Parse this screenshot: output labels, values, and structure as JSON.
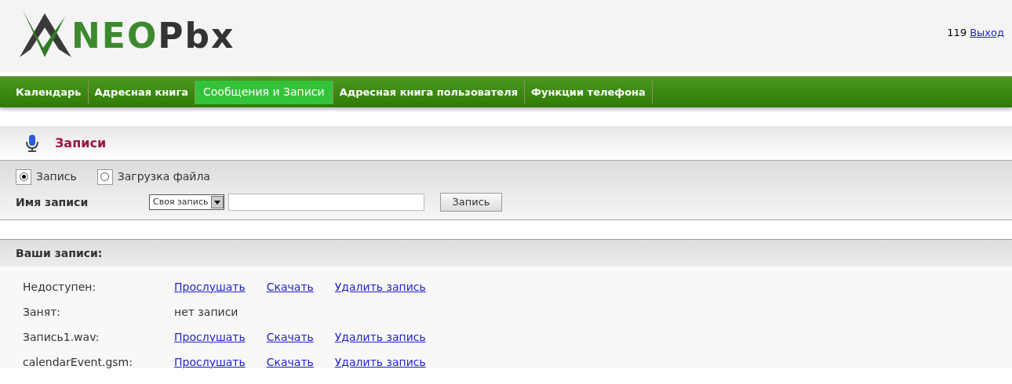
{
  "logo": {
    "mark": "NEO",
    "rest": "Pbx"
  },
  "user": {
    "extension": "119",
    "logout": "Выход"
  },
  "nav": [
    {
      "label": "Календарь",
      "selected": false
    },
    {
      "label": "Адресная книга",
      "selected": false
    },
    {
      "label": "Сообщения и Записи",
      "selected": true
    },
    {
      "label": "Адресная книга пользователя",
      "selected": false
    },
    {
      "label": "Функции телефона",
      "selected": false
    }
  ],
  "section_title": "Записи",
  "source_options": [
    {
      "label": "Запись",
      "selected": true
    },
    {
      "label": "Загрузка файла",
      "selected": false
    }
  ],
  "form": {
    "label": "Имя записи",
    "select_value": "Своя запись",
    "button": "Запись"
  },
  "records": {
    "title": "Ваши записи:",
    "rows": [
      {
        "name": "Недоступен:",
        "actions": [
          "Прослушать",
          "Скачать",
          "Удалить запись"
        ]
      },
      {
        "name": "Занят:",
        "status": "нет записи"
      },
      {
        "name": "Запись1.wav:",
        "actions": [
          "Прослушать",
          "Скачать",
          "Удалить запись"
        ]
      },
      {
        "name": "calendarEvent.gsm:",
        "actions": [
          "Прослушать",
          "Скачать",
          "Удалить запись"
        ]
      }
    ]
  }
}
